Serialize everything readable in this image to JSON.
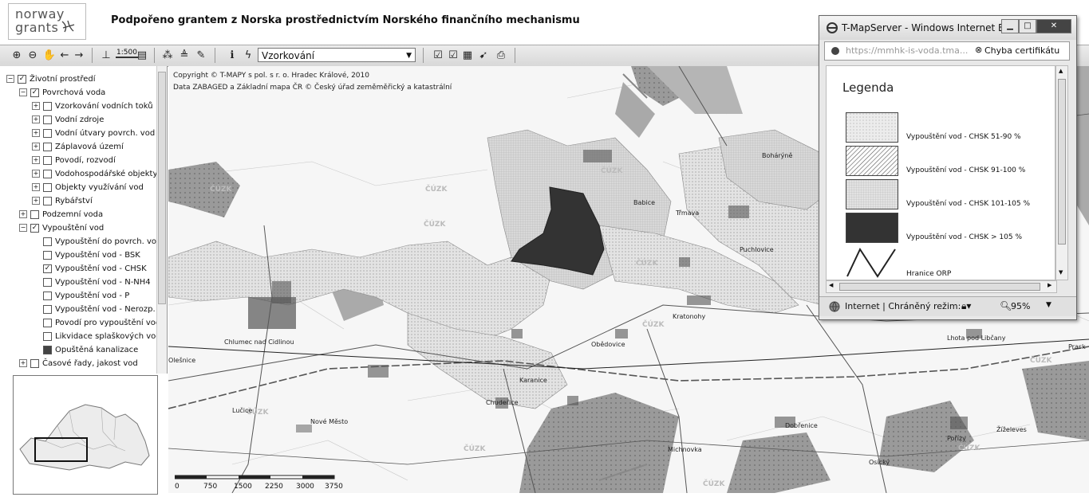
{
  "header": {
    "logo_line1": "norway",
    "logo_line2": "grants",
    "title": "Podpořeno grantem z Norska prostřednictvím Norského finančního mechanismu"
  },
  "toolbar": {
    "scale_label": "1:500",
    "layer_select_value": "Vzorkování",
    "icons": [
      "zoom-in-icon",
      "zoom-out-icon",
      "pan-icon",
      "back-icon",
      "forward-icon",
      "measure-icon",
      "scale-icon",
      "layers-icon",
      "select-icon",
      "print-setup-icon",
      "pencil-icon",
      "info-icon",
      "lightning-icon",
      "checklist-icon",
      "checkbox-icon",
      "table-icon",
      "pointer-icon",
      "print-icon"
    ]
  },
  "tree": {
    "items": [
      {
        "label": "Životní prostředí",
        "checked": true,
        "expander": "−"
      },
      {
        "label": "Povrchová voda",
        "checked": true,
        "expander": "−"
      },
      {
        "label": "Vzorkování vodních toků",
        "checked": false,
        "expander": "+"
      },
      {
        "label": "Vodní zdroje",
        "checked": false,
        "expander": "+"
      },
      {
        "label": "Vodní útvary povrch. vod",
        "checked": false,
        "expander": "+"
      },
      {
        "label": "Záplavová území",
        "checked": false,
        "expander": "+"
      },
      {
        "label": "Povodí, rozvodí",
        "checked": false,
        "expander": "+"
      },
      {
        "label": "Vodohospodářské objekty",
        "checked": false,
        "expander": "+"
      },
      {
        "label": "Objekty využívání vod",
        "checked": false,
        "expander": "+"
      },
      {
        "label": "Rybářství",
        "checked": false,
        "expander": "+"
      },
      {
        "label": "Podzemní voda",
        "checked": false,
        "expander": "+"
      },
      {
        "label": "Vypouštění vod",
        "checked": true,
        "expander": "−"
      },
      {
        "label": "Vypouštění do povrch. vod",
        "checked": false,
        "expander": ""
      },
      {
        "label": "Vypouštění vod - BSK",
        "checked": false,
        "expander": ""
      },
      {
        "label": "Vypouštění vod - CHSK",
        "checked": true,
        "expander": ""
      },
      {
        "label": "Vypouštění vod - N-NH4",
        "checked": false,
        "expander": ""
      },
      {
        "label": "Vypouštění vod - P",
        "checked": false,
        "expander": ""
      },
      {
        "label": "Vypouštění vod - Nerozp.",
        "checked": false,
        "expander": ""
      },
      {
        "label": "Povodí pro vypouštění vod",
        "checked": false,
        "expander": ""
      },
      {
        "label": "Likvidace splaškových vod",
        "checked": false,
        "expander": ""
      },
      {
        "label": "Opuštěná kanalizace",
        "checked": false,
        "filled": true,
        "expander": ""
      },
      {
        "label": "Časové řady, jakost vod",
        "checked": false,
        "expander": "+"
      }
    ]
  },
  "map": {
    "copyright_line1": "Copyright © T-MAPY s pol. s r. o. Hradec Králové, 2010",
    "copyright_line2": "Data ZABAGED a Základní mapa ČR © Český úřad zeměměřický a katastrální",
    "watermark": "ČÚZK",
    "places": [
      "Bohárýně",
      "Babice",
      "Třmava",
      "Puchlovice",
      "Kratonohy",
      "Chlumec nad Cidlinou",
      "Olešnice",
      "Obědovice",
      "Chudeřice",
      "Karanice",
      "Lučice",
      "Nové Město",
      "Michnovka",
      "Dobřenice",
      "Pořízy",
      "Žíželeves",
      "Osický",
      "Lhota pod Libčany",
      "Prask"
    ],
    "scale_ticks": [
      "0",
      "750",
      "1500",
      "2250",
      "3000",
      "3750"
    ]
  },
  "popup": {
    "title": "T-MapServer - Windows Internet E...",
    "url": "https://mmhk-is-voda.tma...",
    "cert_error": "Chyba certifikátu",
    "legend_title": "Legenda",
    "legend": [
      {
        "label": "Vypouštění vod - CHSK 51-90 %",
        "pattern": "dots"
      },
      {
        "label": "Vypouštění vod - CHSK 91-100 %",
        "pattern": "hatch"
      },
      {
        "label": "Vypouštění vod - CHSK 101-105 %",
        "pattern": "grid"
      },
      {
        "label": "Vypouštění vod - CHSK > 105 %",
        "pattern": "solid"
      },
      {
        "label": "Hranice ORP",
        "pattern": "line"
      }
    ],
    "status_zone": "Internet | Chráněný režim:",
    "zoom": "95%"
  }
}
